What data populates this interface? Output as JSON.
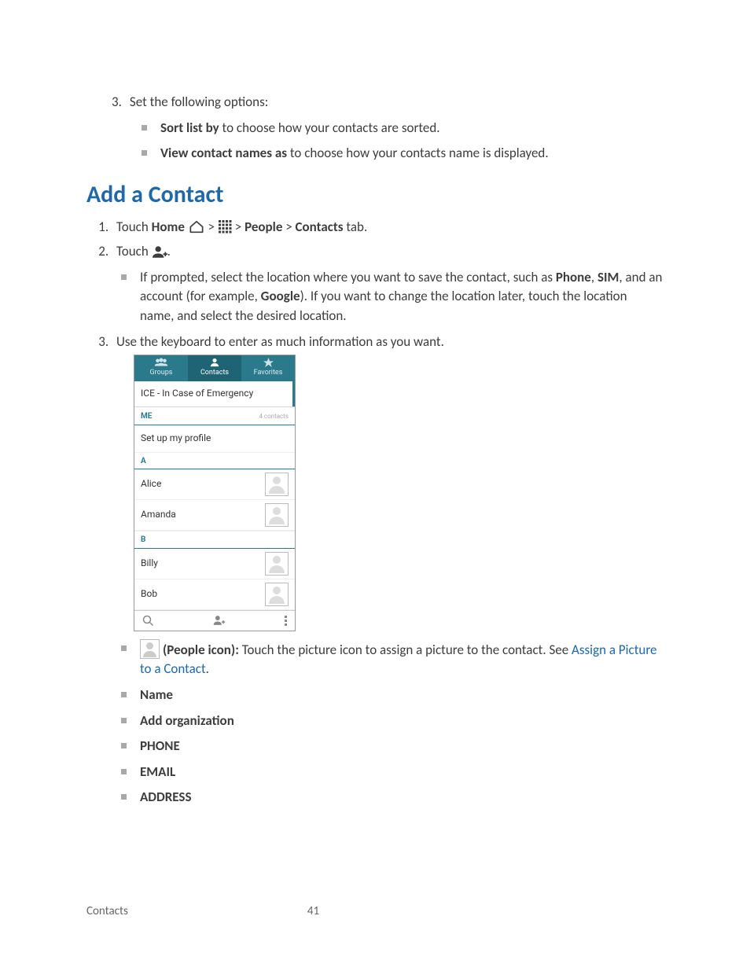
{
  "intro": {
    "num": "3.",
    "intro_text": "Set the following options:",
    "bullets": [
      {
        "bold": "Sort list by",
        "rest": " to choose how your contacts are sorted."
      },
      {
        "bold": "View contact names as",
        "rest": " to choose how your contacts name is displayed."
      }
    ]
  },
  "heading": "Add a Contact",
  "step1": {
    "touch": "Touch ",
    "home": "Home",
    "gt1": " > ",
    "gt2": " > ",
    "people": "People",
    "gt3": " > ",
    "contacts": "Contacts",
    "tab": " tab."
  },
  "step2": {
    "touch": "Touch ",
    "dot": ".",
    "prompt_a": "If prompted, select the location where you want to save the contact, such as ",
    "phone": "Phone",
    "comma1": ", ",
    "sim": "SIM",
    "mid": ", and an account (for example, ",
    "google": "Google",
    "tail": "). If you want to change the location later, touch the location name, and select the desired location."
  },
  "step3": "Use the keyboard to enter as much information as you want.",
  "phone_shot": {
    "tabs": [
      "Groups",
      "Contacts",
      "Favorites"
    ],
    "ice": "ICE - In Case of Emergency",
    "me": "ME",
    "contact_count": "4 contacts",
    "setup": "Set up my profile",
    "letter_a": "A",
    "rows_a": [
      "Alice",
      "Amanda"
    ],
    "letter_b": "B",
    "rows_b": [
      "Billy",
      "Bob"
    ]
  },
  "fields": {
    "people_icon_lead": "(People icon):",
    "people_icon_rest": " Touch the picture icon to assign a picture to the contact. See ",
    "people_icon_link": "Assign a Picture to a Contact",
    "people_icon_dot": ".",
    "items": [
      "Name",
      "Add organization",
      "PHONE",
      "EMAIL",
      "ADDRESS"
    ]
  },
  "footer": {
    "section": "Contacts",
    "page": "41"
  }
}
